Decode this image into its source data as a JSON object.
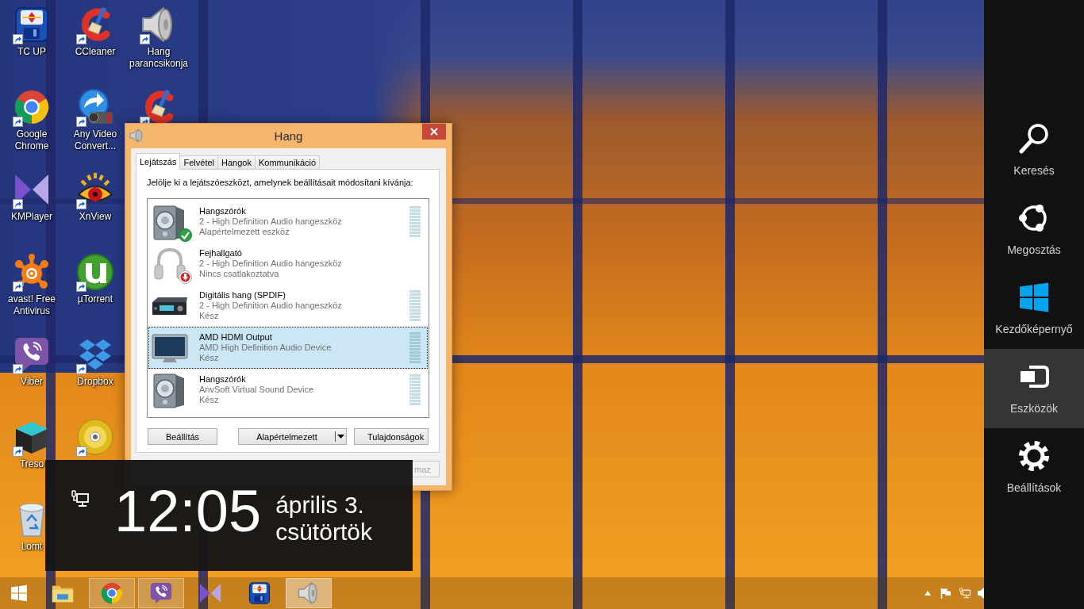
{
  "desktop": {
    "columns": [
      [
        {
          "kind": "tc-up",
          "label": "TC UP",
          "shortcut": true
        },
        {
          "kind": "chrome",
          "label": "Google Chrome",
          "shortcut": true
        },
        {
          "kind": "kmplayer",
          "label": "KMPlayer",
          "shortcut": true
        },
        {
          "kind": "avast",
          "label": "avast! Free Antivirus",
          "shortcut": true
        },
        {
          "kind": "viber",
          "label": "Viber",
          "shortcut": true
        },
        {
          "kind": "cube",
          "label": "Treso",
          "shortcut": true
        },
        {
          "kind": "recycle-bin",
          "label": "Lomt",
          "shortcut": false
        }
      ],
      [
        {
          "kind": "ccleaner",
          "label": "CCleaner",
          "shortcut": true
        },
        {
          "kind": "video-converter",
          "label": "Any Video Convert...",
          "shortcut": true
        },
        {
          "kind": "xnview",
          "label": "XnView",
          "shortcut": true
        },
        {
          "kind": "utorrent",
          "label": "µTorrent",
          "shortcut": true
        },
        {
          "kind": "dropbox",
          "label": "Dropbox",
          "shortcut": true
        },
        {
          "kind": "disc",
          "shortcut": true
        }
      ],
      [
        {
          "kind": "speaker",
          "label": "Hang parancsikonja",
          "shortcut": true
        },
        {
          "kind": "ccleaner",
          "shortcut": true
        }
      ]
    ]
  },
  "dialog": {
    "title": "Hang",
    "tabs": [
      {
        "label": "Lejátszás",
        "selected": true
      },
      {
        "label": "Felvétel",
        "selected": false
      },
      {
        "label": "Hangok",
        "selected": false
      },
      {
        "label": "Kommunikáció",
        "selected": false
      }
    ],
    "instruction": "Jelölje ki a lejátszóeszközt, amelynek beállításait módosítani kívánja:",
    "devices": [
      {
        "kind": "speaker",
        "name": "Hangszórók",
        "driver": "2 - High Definition Audio hangeszköz",
        "status": "Alapértelmezett eszköz",
        "default": true,
        "connected": true,
        "selected": false
      },
      {
        "kind": "headphones",
        "name": "Fejhallgató",
        "driver": "2 - High Definition Audio hangeszköz",
        "status": "Nincs csatlakoztatva",
        "default": false,
        "connected": false,
        "selected": false
      },
      {
        "kind": "receiver",
        "name": "Digitális hang (SPDIF)",
        "driver": "2 - High Definition Audio hangeszköz",
        "status": "Kész",
        "default": false,
        "connected": true,
        "selected": false
      },
      {
        "kind": "monitor",
        "name": "AMD HDMI Output",
        "driver": "AMD High Definition Audio Device",
        "status": "Kész",
        "default": false,
        "connected": true,
        "selected": true
      },
      {
        "kind": "speaker",
        "name": "Hangszórók",
        "driver": "AnvSoft Virtual Sound Device",
        "status": "Kész",
        "default": false,
        "connected": true,
        "selected": false
      }
    ],
    "buttons": [
      {
        "kind": "plain",
        "label": "Beállítás"
      },
      {
        "kind": "split",
        "label": "Alapértelmezett"
      },
      {
        "kind": "plain",
        "label": "Tulajdonságok"
      }
    ],
    "footer_buttons": [
      {
        "label": "maz",
        "disabled": true
      }
    ]
  },
  "clock_flyout": {
    "time": "12:05",
    "date": "április 3.",
    "weekday": "csütörtök"
  },
  "taskbar": {
    "apps": [
      {
        "kind": "explorer",
        "running": false,
        "selected": false
      },
      {
        "kind": "chrome",
        "running": true,
        "selected": false
      },
      {
        "kind": "viber",
        "running": true,
        "selected": false
      },
      {
        "kind": "kmplayer",
        "running": false,
        "selected": false
      },
      {
        "kind": "tc-up",
        "running": false,
        "selected": false
      },
      {
        "kind": "speaker",
        "running": true,
        "selected": true
      }
    ],
    "tray": [
      {
        "kind": "show-hidden"
      },
      {
        "kind": "flag"
      },
      {
        "kind": "network"
      },
      {
        "kind": "volume"
      }
    ]
  },
  "charms": [
    {
      "kind": "search",
      "label": "Keresés",
      "selected": false
    },
    {
      "kind": "share",
      "label": "Megosztás",
      "selected": false
    },
    {
      "kind": "start",
      "label": "Kezdőképernyő",
      "selected": false
    },
    {
      "kind": "devices",
      "label": "Eszközök",
      "selected": true
    },
    {
      "kind": "settings",
      "label": "Beállítások",
      "selected": false
    }
  ]
}
